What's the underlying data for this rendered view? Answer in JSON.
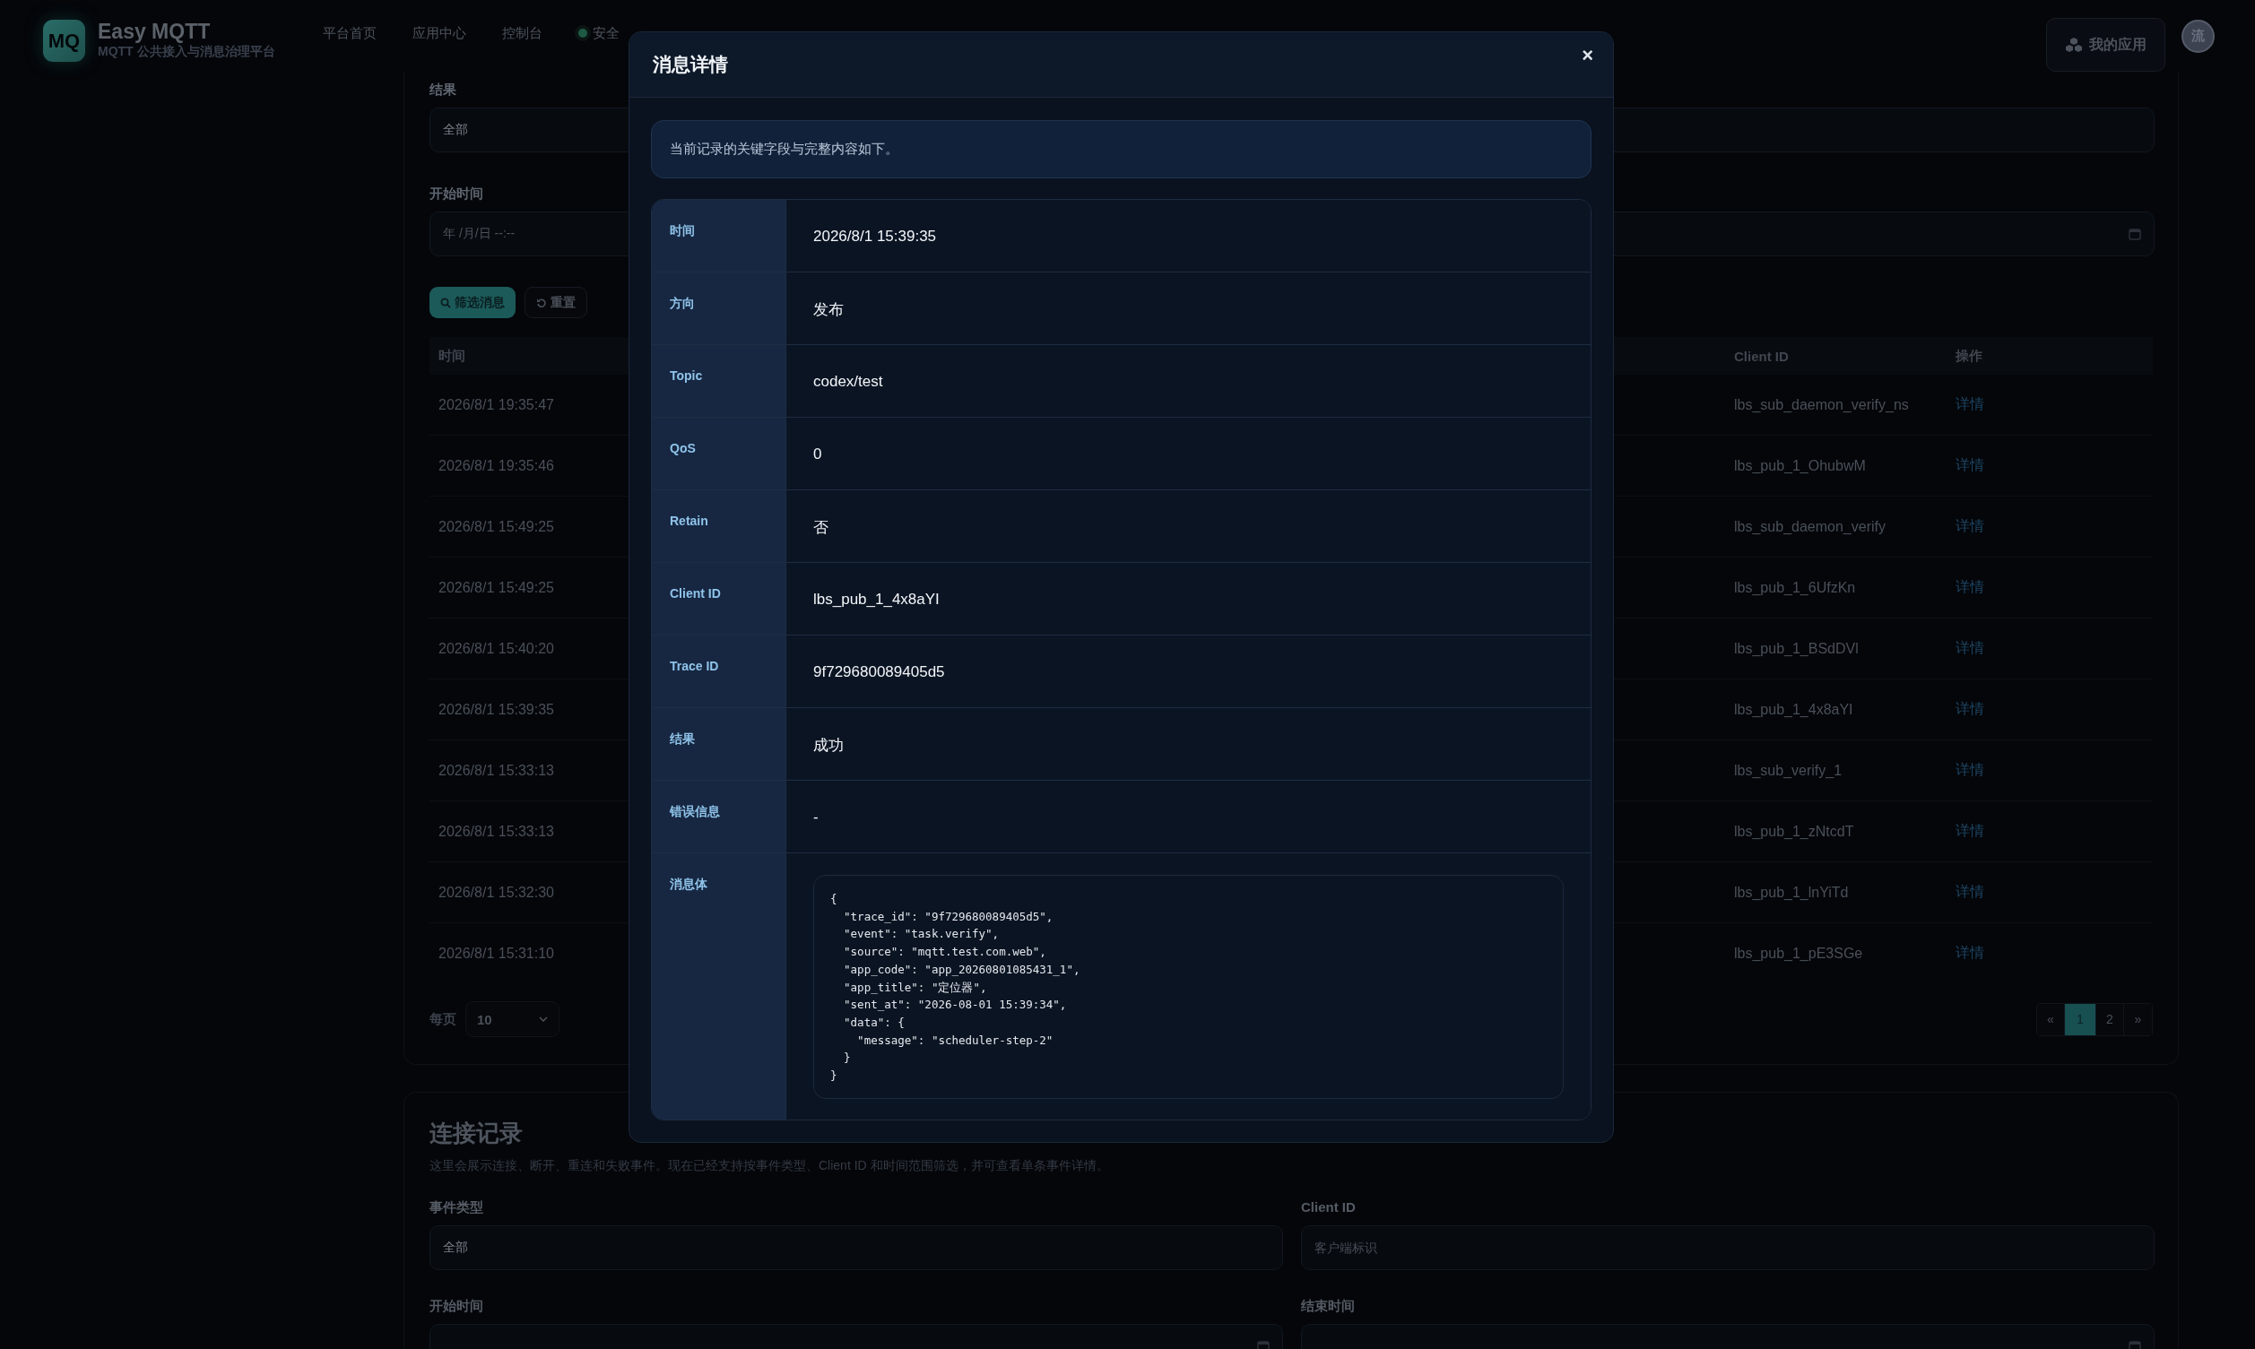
{
  "header": {
    "logo": "MQ",
    "title": "Easy MQTT",
    "subtitle": "MQTT 公共接入与消息治理平台",
    "nav": [
      {
        "label": "平台首页",
        "kind": "link"
      },
      {
        "label": "应用中心",
        "kind": "link"
      },
      {
        "label": "控制台",
        "kind": "link"
      },
      {
        "label": "安全",
        "kind": "status"
      }
    ],
    "apps_button": "我的应用",
    "avatar": "流"
  },
  "message_filters": {
    "fields": [
      {
        "label": "结果",
        "value": "全部"
      },
      {
        "label": "开始时间",
        "placeholder": "年 /月/日 --:--"
      }
    ],
    "right_fields": [
      {
        "kind": "select"
      },
      {
        "kind": "datetime"
      }
    ],
    "buttons": [
      {
        "label": "筛选消息",
        "kind": "primary"
      },
      {
        "label": "重置",
        "kind": "reset"
      }
    ]
  },
  "message_table": {
    "columns": [
      {
        "label": "时间"
      },
      {
        "label": "Client ID"
      },
      {
        "label": "操作"
      }
    ],
    "rows": [
      {
        "time": "2026/8/1 19:35:47",
        "client_id": "lbs_sub_daemon_verify_ns",
        "action": "详情"
      },
      {
        "time": "2026/8/1 19:35:46",
        "client_id": "lbs_pub_1_OhubwM",
        "action": "详情"
      },
      {
        "time": "2026/8/1 15:49:25",
        "client_id": "lbs_sub_daemon_verify",
        "action": "详情"
      },
      {
        "time": "2026/8/1 15:49:25",
        "client_id": "lbs_pub_1_6UfzKn",
        "action": "详情"
      },
      {
        "time": "2026/8/1 15:40:20",
        "client_id": "lbs_pub_1_BSdDVl",
        "action": "详情"
      },
      {
        "time": "2026/8/1 15:39:35",
        "client_id": "lbs_pub_1_4x8aYI",
        "action": "详情"
      },
      {
        "time": "2026/8/1 15:33:13",
        "client_id": "lbs_sub_verify_1",
        "action": "详情"
      },
      {
        "time": "2026/8/1 15:33:13",
        "client_id": "lbs_pub_1_zNtcdT",
        "action": "详情"
      },
      {
        "time": "2026/8/1 15:32:30",
        "client_id": "lbs_pub_1_lnYiTd",
        "action": "详情"
      },
      {
        "time": "2026/8/1 15:31:10",
        "client_id": "lbs_pub_1_pE3SGe",
        "action": "详情"
      }
    ],
    "page_size_label": "每页",
    "page_size": "10",
    "pages": [
      {
        "label": "«",
        "selected": false
      },
      {
        "label": "1",
        "selected": true
      },
      {
        "label": "2",
        "selected": false
      },
      {
        "label": "»",
        "selected": false
      }
    ]
  },
  "connection_records": {
    "title": "连接记录",
    "description": "这里会展示连接、断开、重连和失败事件。现在已经支持按事件类型、Client ID 和时间范围筛选，并可查看单条事件详情。",
    "fields": [
      {
        "label": "事件类型",
        "value": "全部",
        "kind": "select"
      },
      {
        "label": "Client ID",
        "placeholder": "客户端标识",
        "kind": "text"
      },
      {
        "label": "开始时间",
        "kind": "datetime"
      },
      {
        "label": "结束时间",
        "kind": "datetime"
      }
    ]
  },
  "modal": {
    "title": "消息详情",
    "close": "×",
    "notice": "当前记录的关键字段与完整内容如下。",
    "fields": [
      {
        "label": "时间",
        "value": "2026/8/1 15:39:35",
        "kind": "text"
      },
      {
        "label": "方向",
        "value": "发布",
        "kind": "text"
      },
      {
        "label": "Topic",
        "value": "codex/test",
        "kind": "text"
      },
      {
        "label": "QoS",
        "value": "0",
        "kind": "text"
      },
      {
        "label": "Retain",
        "value": "否",
        "kind": "text"
      },
      {
        "label": "Client ID",
        "value": "lbs_pub_1_4x8aYI",
        "kind": "text"
      },
      {
        "label": "Trace ID",
        "value": "9f729680089405d5",
        "kind": "text"
      },
      {
        "label": "结果",
        "value": "成功",
        "kind": "text"
      },
      {
        "label": "错误信息",
        "value": "-",
        "kind": "text"
      },
      {
        "label": "消息体",
        "value": "{\n  \"trace_id\": \"9f729680089405d5\",\n  \"event\": \"task.verify\",\n  \"source\": \"mqtt.test.com.web\",\n  \"app_code\": \"app_20260801085431_1\",\n  \"app_title\": \"定位器\",\n  \"sent_at\": \"2026-08-01 15:39:34\",\n  \"data\": {\n    \"message\": \"scheduler-step-2\"\n  }\n}",
        "kind": "code"
      }
    ]
  }
}
